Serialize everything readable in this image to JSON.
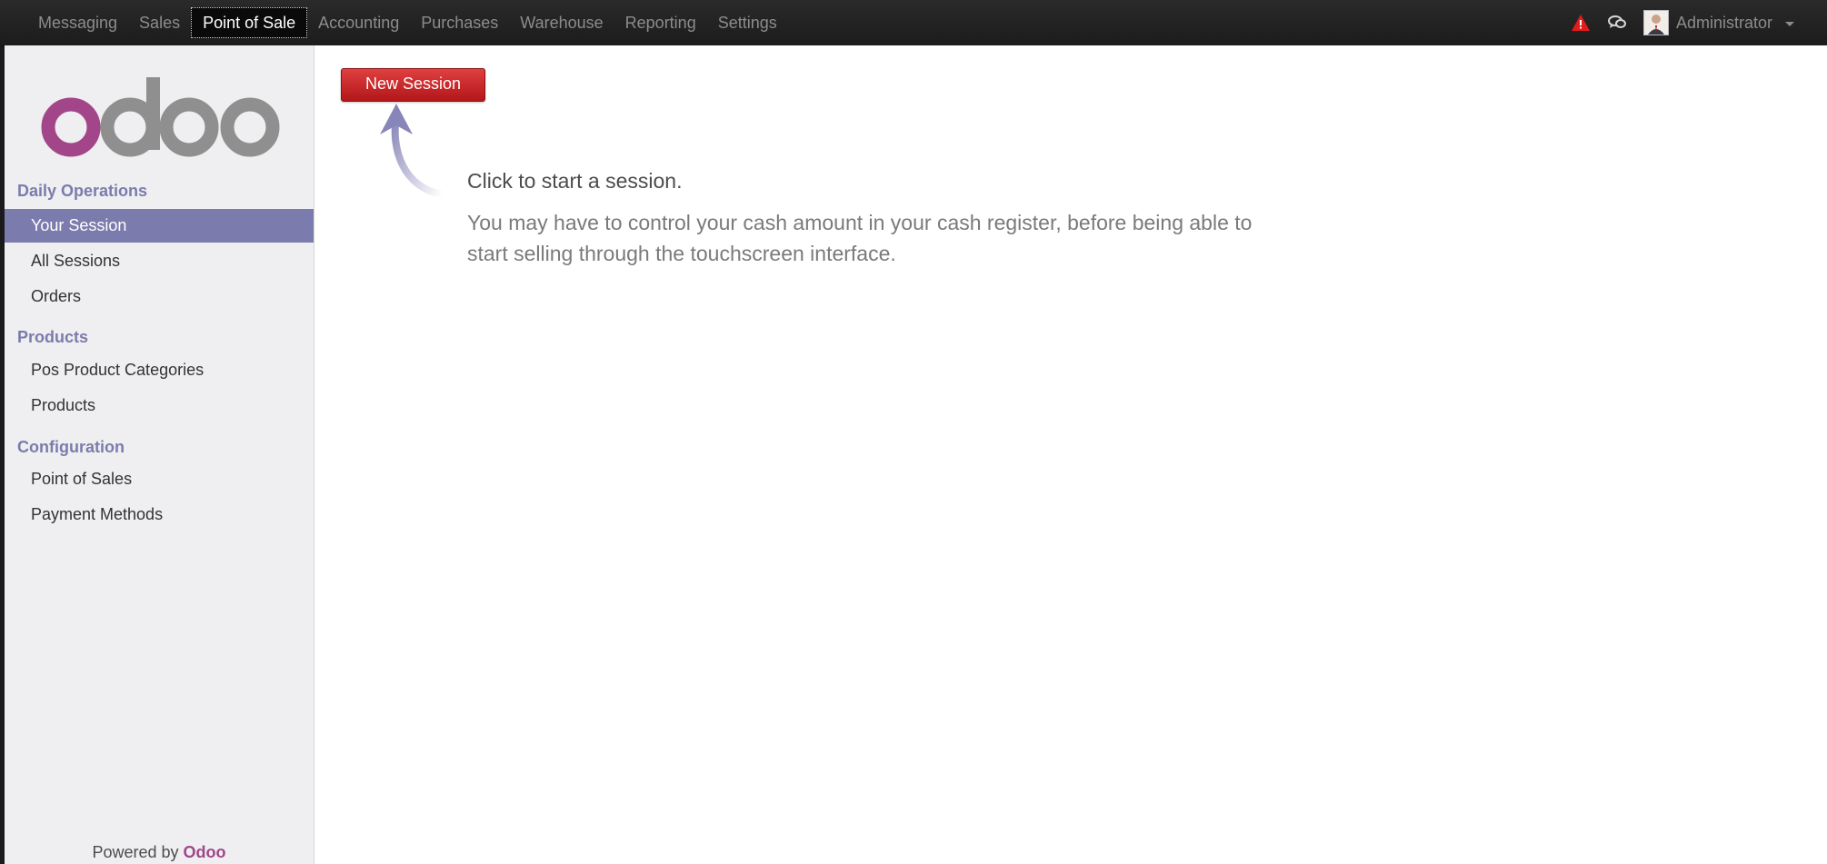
{
  "topnav": {
    "items": [
      {
        "label": "Messaging"
      },
      {
        "label": "Sales"
      },
      {
        "label": "Point of Sale"
      },
      {
        "label": "Accounting"
      },
      {
        "label": "Purchases"
      },
      {
        "label": "Warehouse"
      },
      {
        "label": "Reporting"
      },
      {
        "label": "Settings"
      }
    ],
    "active": "Point of Sale",
    "user_name": "Administrator",
    "icons": [
      "warning-icon",
      "chat-icon",
      "avatar",
      "chevron-down-icon"
    ]
  },
  "sidebar": {
    "logo_text": "odoo",
    "sections": [
      {
        "title": "Daily Operations",
        "items": [
          "Your Session",
          "All Sessions",
          "Orders"
        ]
      },
      {
        "title": "Products",
        "items": [
          "Pos Product Categories",
          "Products"
        ]
      },
      {
        "title": "Configuration",
        "items": [
          "Point of Sales",
          "Payment Methods"
        ]
      }
    ],
    "active_item": "Your Session",
    "footer_prefix": "Powered by",
    "footer_brand": "Odoo"
  },
  "main": {
    "new_session_label": "New Session",
    "help_title": "Click to start a session.",
    "help_text": "You may have to control your cash amount in your cash register, before being able to start selling through the touchscreen interface."
  },
  "colors": {
    "accent": "#7c7bad",
    "brand": "#a24689",
    "button": "#c8282a",
    "topbar": "#222222"
  }
}
